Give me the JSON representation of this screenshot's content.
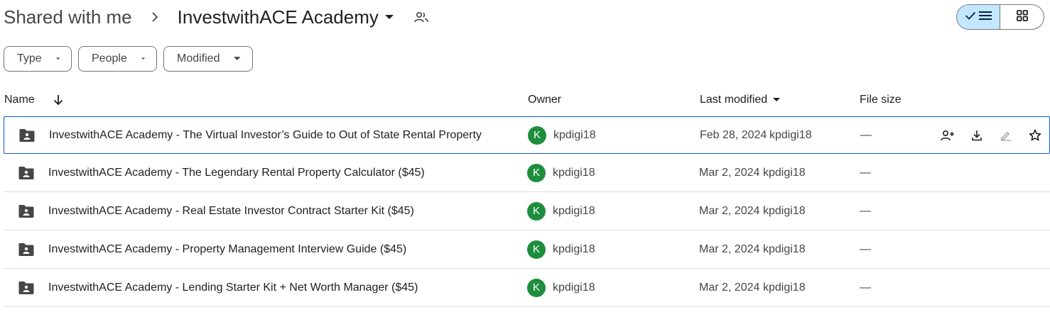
{
  "breadcrumb": {
    "root": "Shared with me",
    "separator_icon": "chevron-right-icon",
    "current": "InvestwithACE Academy",
    "caret_icon": "arrow-drop-down-icon",
    "shared_icon": "people-icon"
  },
  "view_toggle": {
    "selected": "list",
    "list_icons": [
      "check-icon",
      "list-icon"
    ],
    "grid_icon": "grid-icon"
  },
  "filters": {
    "type": "Type",
    "people": "People",
    "modified": "Modified"
  },
  "columns": {
    "name": "Name",
    "owner": "Owner",
    "last_modified": "Last modified",
    "file_size": "File size"
  },
  "rows": [
    {
      "name": "InvestwithACE Academy - The Virtual Investor’s Guide to Out of State Rental Property",
      "owner": "kpdigi18",
      "avatar": "K",
      "date": "Feb 28, 2024",
      "modified_by": "kpdigi18",
      "size": "—"
    },
    {
      "name": "InvestwithACE Academy - The Legendary Rental Property Calculator ($45)",
      "owner": "kpdigi18",
      "avatar": "K",
      "date": "Mar 2, 2024",
      "modified_by": "kpdigi18",
      "size": "—"
    },
    {
      "name": "InvestwithACE Academy - Real Estate Investor Contract Starter Kit ($45)",
      "owner": "kpdigi18",
      "avatar": "K",
      "date": "Mar 2, 2024",
      "modified_by": "kpdigi18",
      "size": "—"
    },
    {
      "name": "InvestwithACE Academy - Property Management Interview Guide ($45)",
      "owner": "kpdigi18",
      "avatar": "K",
      "date": "Mar 2, 2024",
      "modified_by": "kpdigi18",
      "size": "—"
    },
    {
      "name": "InvestwithACE Academy - Lending Starter Kit + Net Worth Manager ($45)",
      "owner": "kpdigi18",
      "avatar": "K",
      "date": "Mar 2, 2024",
      "modified_by": "kpdigi18",
      "size": "—"
    }
  ],
  "row_actions": [
    "share-icon",
    "download-icon",
    "rename-icon",
    "star-icon"
  ],
  "colors": {
    "accent": "#0b57d0",
    "toggle_bg": "#c2e7ff",
    "avatar": "#1e8e3e",
    "icon": "#444746"
  }
}
